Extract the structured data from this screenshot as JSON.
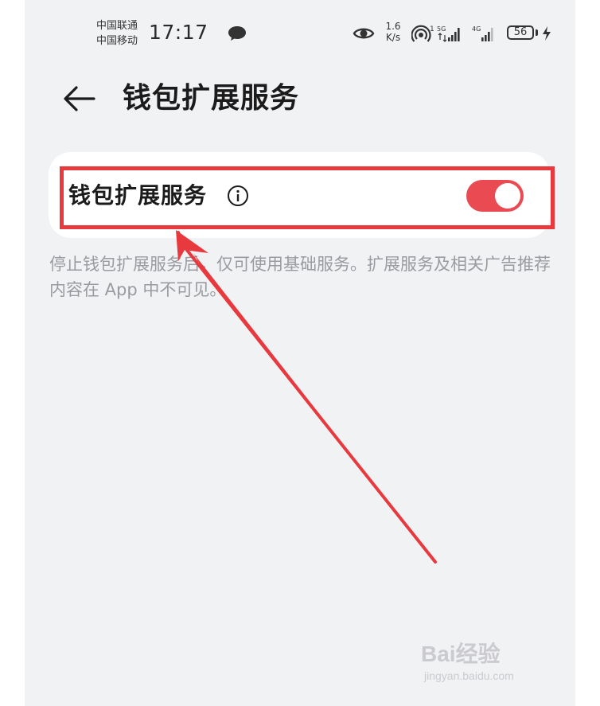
{
  "status_bar": {
    "carrier_1": "中国联通",
    "carrier_2": "中国移动",
    "time": "17:17",
    "net_speed_value": "1.6",
    "net_speed_unit": "K/s",
    "hotspot_label": "1",
    "sim1_label": "5G",
    "sim2_label": "4G",
    "battery_level": "56",
    "icons": [
      "message-icon",
      "eye-icon",
      "hotspot-icon",
      "signal-5g-icon",
      "signal-4g-icon",
      "battery-icon",
      "charging-icon"
    ]
  },
  "header": {
    "title": "钱包扩展服务",
    "back_icon": "back-arrow-icon"
  },
  "setting": {
    "label": "钱包扩展服务",
    "info_icon": "info-icon",
    "toggle_on": true,
    "description": "停止钱包扩展服务后，仅可使用基础服务。扩展服务及相关广告推荐内容在 App 中不可见。"
  },
  "annotation": {
    "color": "#e8393f"
  },
  "watermark": {
    "brand": "Bai经验",
    "url": "jingyan.baidu.com"
  },
  "colors": {
    "background": "#f1f2f4",
    "card": "#ffffff",
    "toggle_active": "#ea4a52",
    "highlight": "#e8393f",
    "secondary_text": "#9a9ba0"
  }
}
